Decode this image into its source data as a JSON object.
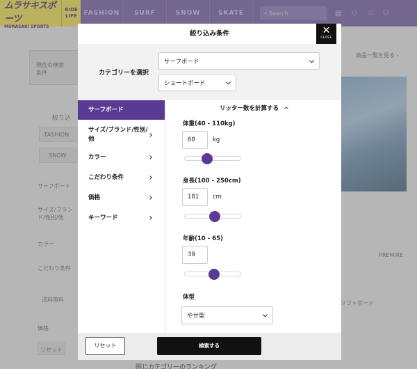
{
  "site": {
    "logo_main": "ムラサキスポーツ",
    "logo_sub": "MURASAKI SPORTS",
    "ride_line1": "RIDE",
    "ride_line2": "LIFE",
    "nav": [
      "FASHION",
      "SURF",
      "SNOW",
      "SKATE"
    ],
    "search_placeholder": "Search"
  },
  "background": {
    "current_condition": "現在の検索条件",
    "list_link": "商品一覧を見る ›",
    "narrow": "絞り込",
    "chip_fashion": "FASHION",
    "chip_snow": "SNOW",
    "surfboard": "サーフボード",
    "size_brand": "サイズ/ブランド/性別/他",
    "color": "カラー",
    "kodawari": "こだわり条件",
    "free_ship": "送料無料",
    "price": "価格",
    "reset": "リセット",
    "softboard": "ソフトボード",
    "premire": "PREMIRE",
    "ranking": "同じカテゴリーのランキング"
  },
  "modal": {
    "title": "絞り込み条件",
    "close_label": "CLOSE",
    "category_label": "カテゴリーを選択",
    "category_select": "サーフボード",
    "subcategory_select": "ショートボード",
    "sidebar": [
      {
        "label": "サーフボード",
        "active": true
      },
      {
        "label": "サイズ/ブランド/性別/他",
        "active": false
      },
      {
        "label": "カラー",
        "active": false
      },
      {
        "label": "こだわり条件",
        "active": false
      },
      {
        "label": "価格",
        "active": false
      },
      {
        "label": "キーワード",
        "active": false
      }
    ],
    "liter_heading": "リッター数を計算する",
    "weight": {
      "label": "体重(40 - 110kg)",
      "value": "68",
      "unit": "kg",
      "slider_fraction": 0.4
    },
    "height": {
      "label": "身長(100 - 250cm)",
      "value": "181",
      "unit": "cm",
      "slider_fraction": 0.54
    },
    "age": {
      "label": "年齢(10 - 65)",
      "value": "39",
      "slider_fraction": 0.53
    },
    "body_type": {
      "label": "体型",
      "value": "やせ型"
    },
    "reset_label": "リセット",
    "search_label": "検索する"
  },
  "colors": {
    "accent": "#5a3a93",
    "topbar": "#6f5aa3",
    "logo": "#f3e04a"
  }
}
